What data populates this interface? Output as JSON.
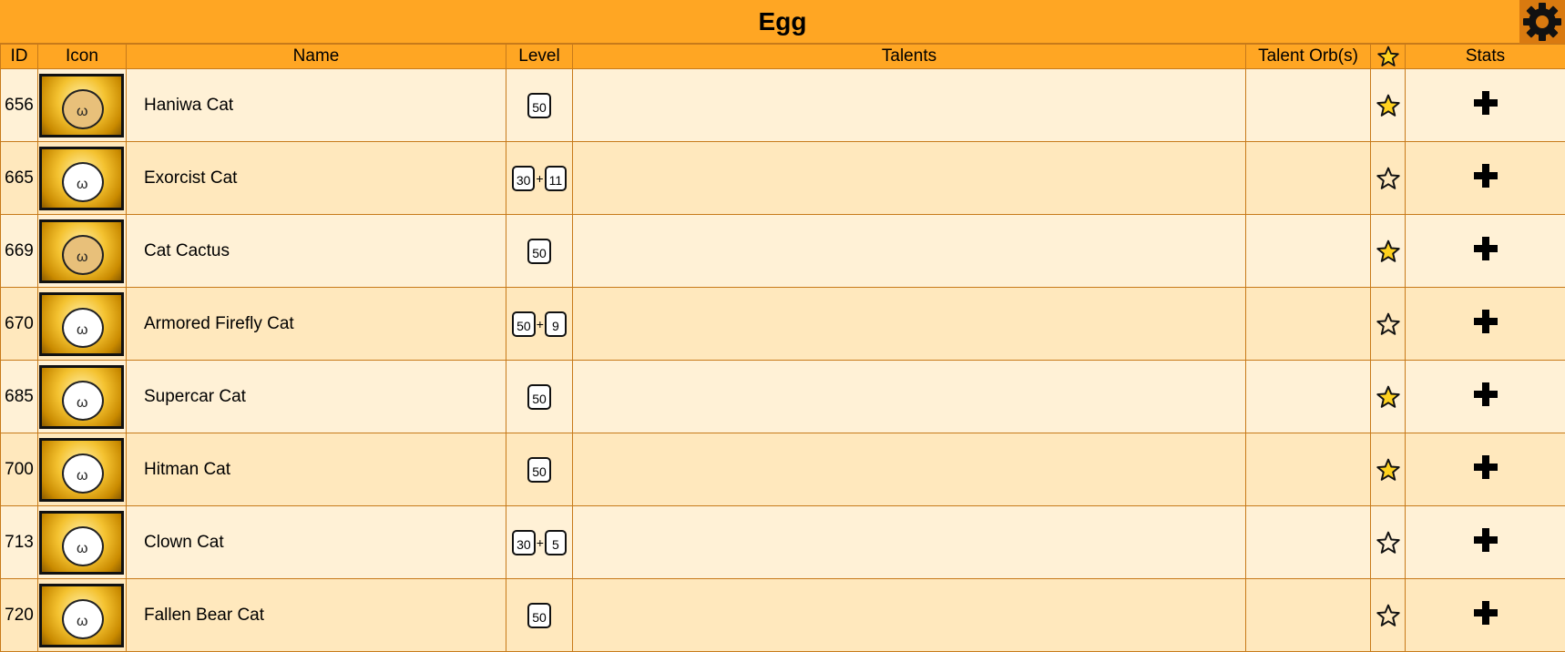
{
  "header": {
    "title": "Egg",
    "settings_icon": "gear-icon"
  },
  "columns": {
    "id": "ID",
    "icon": "Icon",
    "name": "Name",
    "level": "Level",
    "talents": "Talents",
    "orbs": "Talent Orb(s)",
    "favorite_icon": "star-icon",
    "stats": "Stats"
  },
  "rows": [
    {
      "id": "656",
      "name": "Haniwa Cat",
      "level": "50",
      "plus": "",
      "favorite": true
    },
    {
      "id": "665",
      "name": "Exorcist Cat",
      "level": "30",
      "plus": "11",
      "favorite": false
    },
    {
      "id": "669",
      "name": "Cat Cactus",
      "level": "50",
      "plus": "",
      "favorite": true
    },
    {
      "id": "670",
      "name": "Armored Firefly Cat",
      "level": "50",
      "plus": "9",
      "favorite": false
    },
    {
      "id": "685",
      "name": "Supercar Cat",
      "level": "50",
      "plus": "",
      "favorite": true
    },
    {
      "id": "700",
      "name": "Hitman Cat",
      "level": "50",
      "plus": "",
      "favorite": true
    },
    {
      "id": "713",
      "name": "Clown Cat",
      "level": "30",
      "plus": "5",
      "favorite": false
    },
    {
      "id": "720",
      "name": "Fallen Bear Cat",
      "level": "50",
      "plus": "",
      "favorite": false
    }
  ],
  "level_separator": "+",
  "stats_symbol": "✚",
  "colors": {
    "header_bg": "#ffa623",
    "row_odd": "#fff1d6",
    "row_even": "#ffe8bd",
    "star_fill": "#ffd21f",
    "border": "#c77a1a"
  }
}
